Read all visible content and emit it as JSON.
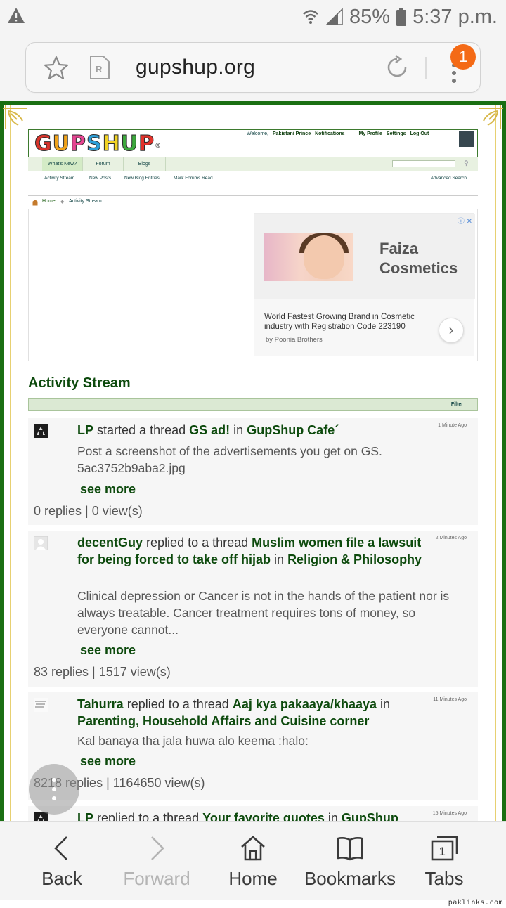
{
  "status_bar": {
    "battery": "85%",
    "time": "5:37 p.m."
  },
  "browser": {
    "url": "gupshup.org",
    "menu_badge": "1"
  },
  "site": {
    "logo": {
      "letters": [
        "G",
        "U",
        "P",
        "S",
        "H",
        "U",
        "P"
      ],
      "colors": [
        "#d8332b",
        "#f0a31a",
        "#e64592",
        "#2d9fd8",
        "#f2d324",
        "#3ca83c",
        "#e2322b"
      ],
      "reg": "®"
    },
    "header_links": {
      "welcome": "Welcome,",
      "user": "Pakistani Prince",
      "notifications": "Notifications",
      "profile": "My Profile",
      "settings": "Settings",
      "logout": "Log Out"
    },
    "nav_tabs": [
      "What's New?",
      "Forum",
      "Blogs"
    ],
    "sub_nav": [
      "Activity Stream",
      "New Posts",
      "New Blog Entries",
      "Mark Forums Read"
    ],
    "advanced_search": "Advanced Search",
    "breadcrumb": {
      "home": "Home",
      "current": "Activity Stream"
    }
  },
  "ad": {
    "brand": "Faiza Cosmetics",
    "description": "World Fastest Growing Brand in Cosmetic industry with Registration Code 223190",
    "by": "by Poonia Brothers",
    "info_icons": "ⓘ ✕"
  },
  "stream": {
    "title": "Activity Stream",
    "filter": "Filter",
    "items": [
      {
        "user": "LP",
        "action": "started a thread",
        "thread": "GS ad!",
        "in": "in",
        "forum": "GupShup Cafe´",
        "time": "1 Minute Ago",
        "body": "Post a screenshot of the advertisements you get on GS. 5ac3752b9aba2.jpg",
        "see_more": "see more",
        "stats": "0 replies | 0 view(s)"
      },
      {
        "user": "decentGuy",
        "action": "replied to a thread",
        "thread": "Muslim women file a lawsuit for being forced to take off hijab",
        "in": "in",
        "forum": "Religion & Philosophy",
        "time": "2 Minutes Ago",
        "body": "Clinical depression or Cancer is not in the hands of the patient nor is always treatable. Cancer treatment requires tons of money, so everyone cannot...",
        "see_more": "see more",
        "stats": "83 replies | 1517 view(s)"
      },
      {
        "user": "Tahurra",
        "action": "replied to a thread",
        "thread": "Aaj kya pakaaya/khaaya",
        "in": "in",
        "forum": "Parenting, Household Affairs and Cuisine corner",
        "time": "11 Minutes Ago",
        "body": "Kal banaya tha jala huwa alo keema :halo:",
        "see_more": "see more",
        "stats": "8218 replies | 1164650 view(s)"
      },
      {
        "user": "LP",
        "action": "replied to a thread",
        "thread": "Your favorite quotes",
        "in": "in",
        "forum": "GupShup",
        "time": "15 Minutes Ago"
      }
    ]
  },
  "bottom_nav": [
    "Back",
    "Forward",
    "Home",
    "Bookmarks",
    "Tabs"
  ],
  "tabs_count": "1",
  "watermark": "paklinks.com"
}
